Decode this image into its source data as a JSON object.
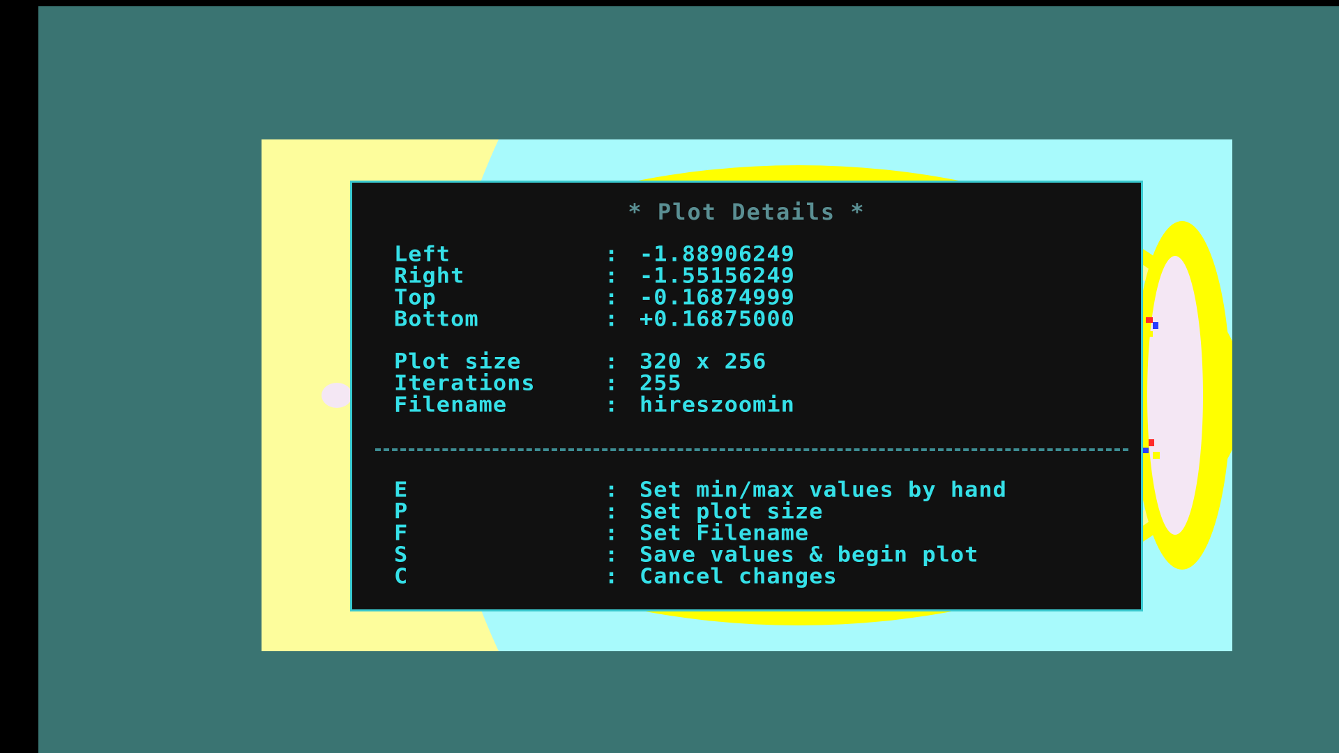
{
  "dialog": {
    "title": "* Plot Details *",
    "separator": ":",
    "bounds": [
      {
        "label": "Left",
        "value": "-1.88906249"
      },
      {
        "label": "Right",
        "value": "-1.55156249"
      },
      {
        "label": "Top",
        "value": "-0.16874999"
      },
      {
        "label": "Bottom",
        "value": "+0.16875000"
      }
    ],
    "settings": [
      {
        "label": "Plot size",
        "value": "320 x 256"
      },
      {
        "label": "Iterations",
        "value": "255"
      },
      {
        "label": "Filename",
        "value": "hireszoomin"
      }
    ],
    "commands": [
      {
        "key": "E",
        "action": "Set min/max values by hand"
      },
      {
        "key": "P",
        "action": "Set plot size"
      },
      {
        "key": "F",
        "action": "Set Filename"
      },
      {
        "key": "S",
        "action": "Save values & begin plot"
      },
      {
        "key": "C",
        "action": "Cancel changes"
      }
    ]
  },
  "colors": {
    "border": "#3a7472",
    "text": "#35e0e8",
    "title": "#5a8f93",
    "dialog_bg": "#111111",
    "fractal_yellow": "#ffff00",
    "fractal_pale_yellow": "#fdfd9c",
    "fractal_cyan": "#a8fafc"
  }
}
